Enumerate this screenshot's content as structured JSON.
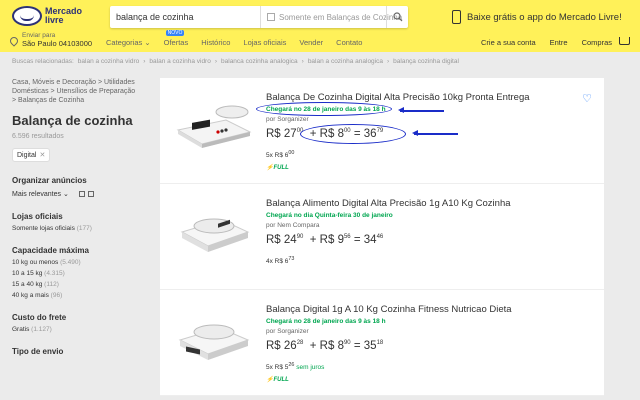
{
  "header": {
    "logo_line1": "Mercado",
    "logo_line2": "livre",
    "search_value": "balança de cozinha",
    "official_only": "Somente em Balanças de Cozinha",
    "promo": "Baixe grátis o app do Mercado Livre!",
    "location_label": "Enviar para",
    "location_value": "São Paulo 04103000",
    "nav": [
      "Categorias ⌄",
      "Ofertas",
      "Histórico",
      "Lojas oficiais",
      "Vender",
      "Contato"
    ],
    "novo_badge": "NOVO",
    "right_nav": [
      "Crie a sua conta",
      "Entre",
      "Compras"
    ]
  },
  "related": {
    "label": "Buscas relacionadas:",
    "items": [
      "balan a cozinha vidro",
      "balan a cozinha vidro",
      "balanca cozinha analogica",
      "balan a cozinha analogica",
      "balança cozinha digital"
    ]
  },
  "sidebar": {
    "crumb": "Casa, Móveis e Decoração > Utilidades Domésticas > Utensílios de Preparação > Balanças de Cozinha",
    "title": "Balança de cozinha",
    "count": "6.596 resultados",
    "chip": "Digital",
    "organize_title": "Organizar anúncios",
    "sort_label": "Mais relevantes ⌄",
    "stores_title": "Lojas oficiais",
    "stores_item": "Somente lojas oficiais",
    "stores_count": "(177)",
    "capacity_title": "Capacidade máxima",
    "capacity": [
      {
        "label": "10 kg ou menos",
        "count": "(5.490)"
      },
      {
        "label": "10 a 15 kg",
        "count": "(4.315)"
      },
      {
        "label": "15 a 40 kg",
        "count": "(112)"
      },
      {
        "label": "40 kg a mais",
        "count": "(96)"
      }
    ],
    "freight_title": "Custo do frete",
    "freight_item": "Gratis",
    "freight_count": "(1.127)",
    "shipping_title": "Tipo de envio"
  },
  "items": [
    {
      "title": "Balança De Cozinha Digital Alta Precisão 10kg Pronta Entrega",
      "ship": "Chegará no 28 de janeiro das 9 às 18 h",
      "seller": "por Sorganizer",
      "price_int": "R$ 27",
      "price_cents": "00",
      "freight_int": "+ R$ 8",
      "freight_cents": "00",
      "total_int": "= 36",
      "total_cents": "79",
      "installments": "5x R$ 6",
      "installments_cents": "00",
      "full": "⚡FULL"
    },
    {
      "title": "Balança Alimento Digital Alta Precisão 1g A10 Kg Cozinha",
      "ship": "Chegará no dia Quinta-feira 30 de janeiro",
      "seller": "por Nem Compara",
      "price_int": "R$ 24",
      "price_cents": "90",
      "freight_int": "+ R$ 9",
      "freight_cents": "56",
      "total_int": "= 34",
      "total_cents": "46",
      "installments": "4x R$ 6",
      "installments_cents": "73",
      "full": ""
    },
    {
      "title": "Balança Digital 1g A 10 Kg Cozinha Fitness Nutricao Dieta",
      "ship": "Chegará no 28 de janeiro das 9 às 18 h",
      "seller": "por Sorganizer",
      "price_int": "R$ 26",
      "price_cents": "28",
      "freight_int": "+ R$ 8",
      "freight_cents": "90",
      "total_int": "= 35",
      "total_cents": "18",
      "installments": "5x R$ 5",
      "installments_cents": "26",
      "installments_note": "sem juros",
      "full": "⚡FULL"
    }
  ],
  "colors": {
    "header": "#fff159",
    "shipping": "#00a650",
    "annotation": "#1a2cc8",
    "link": "#3483fa"
  }
}
